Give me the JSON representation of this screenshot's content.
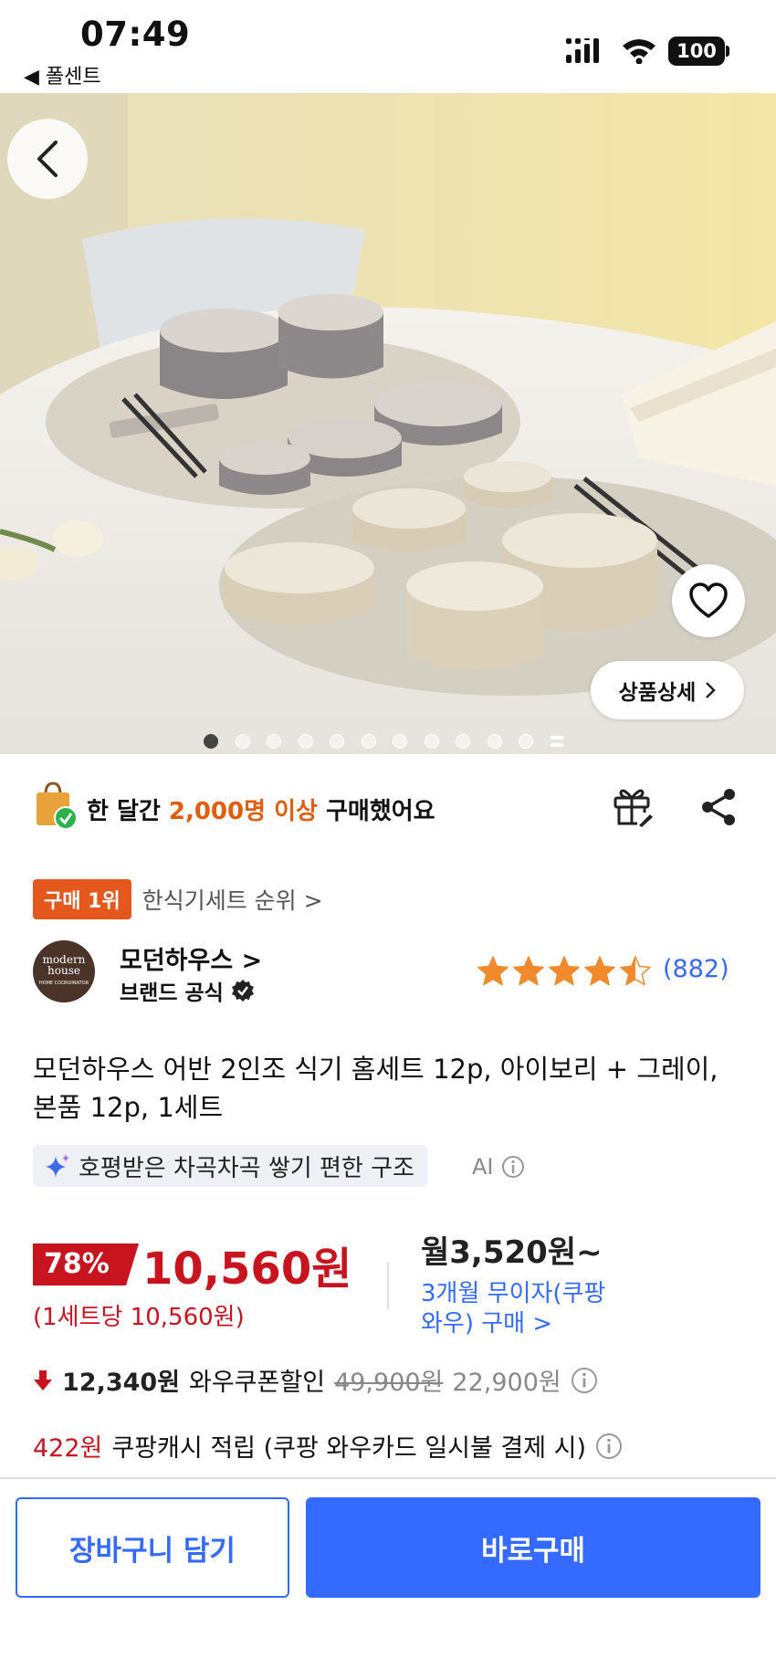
{
  "status_bar": {
    "time": "07:49",
    "back_app": "◀ 폴센트",
    "battery": "100"
  },
  "hero": {
    "detail_button": "상품상세",
    "page_count": 11,
    "active_page": 1
  },
  "buyers": {
    "prefix": "한 달간 ",
    "highlight": "2,000명 이상",
    "suffix": " 구매했어요"
  },
  "rank": {
    "badge": "구매 1위",
    "category": "한식기세트 순위 >"
  },
  "brand": {
    "logo_text": "modern house",
    "logo_subtext": "HOME COORDINATOR",
    "name": "모던하우스 >",
    "official": "브랜드 공식",
    "rating": 4.5,
    "review_count": "(882)"
  },
  "product": {
    "title": "모던하우스 어반 2인조 식기 홈세트 12p, 아이보리 + 그레이, 본품 12p, 1세트",
    "ai_summary": "호평받은 차곡차곡 쌓기 편한 구조",
    "ai_label": "AI"
  },
  "price": {
    "discount": "78%",
    "final": "10,560원",
    "unit_price": "(1세트당 10,560원)",
    "monthly": "월3,520원~",
    "installment": "3개월 무이자(쿠팡 와우) 구매 >"
  },
  "coupon": {
    "saved": "12,340원",
    "label": "와우쿠폰할인",
    "original": "49,900원",
    "sale": "22,900원"
  },
  "cash": {
    "amount": "422원",
    "label": "쿠팡캐시 적립 (쿠팡 와우카드 일시불 결제 시)"
  },
  "actions": {
    "cart": "장바구니 담기",
    "buy": "바로구매"
  },
  "colors": {
    "accent_blue": "#346aff",
    "price_red": "#c8141f",
    "highlight_orange": "#e25d0b"
  }
}
